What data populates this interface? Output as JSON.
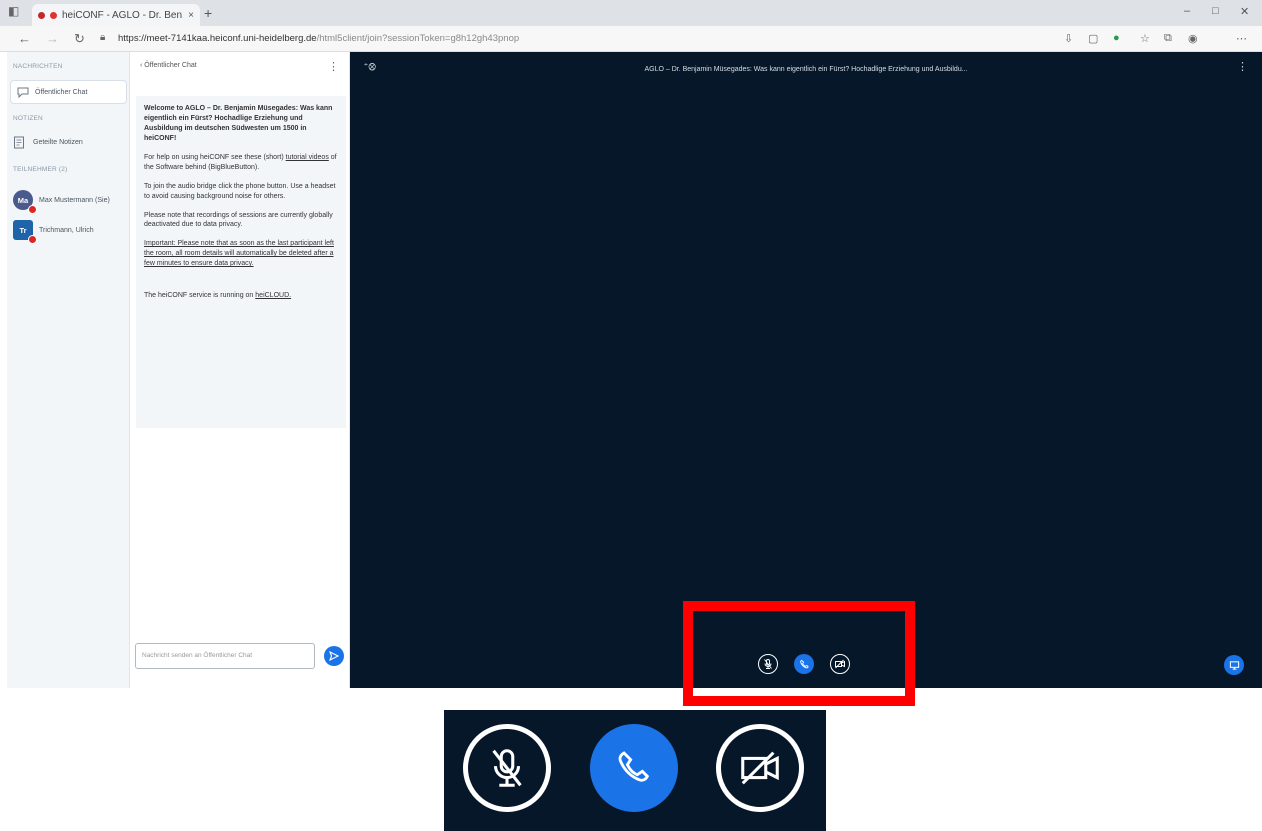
{
  "browser": {
    "tab_title": "hei­CONF - AGLO - Dr. Ben...",
    "tab_close": "×",
    "new_tab": "+",
    "url_host": "https://meet-7141kaa.heiconf.uni-heidelberg.de",
    "url_path": "/html5client/join?sessionToken=g8h12gh43pnop",
    "icons": [
      "back-icon",
      "forward-icon",
      "refresh-icon",
      "lock-icon"
    ]
  },
  "userlist": {
    "messages_title": "NACHRICHTEN",
    "public_chat": "Öffentlicher Chat",
    "notes_title": "NOTIZEN",
    "shared_notes": "Geteilte Notizen",
    "participants_title": "TEILNEHMER (2)",
    "users": [
      {
        "initials": "Ma",
        "name": "Max Mustermann (Sie)",
        "color": "#4a5a8c"
      },
      {
        "initials": "Tr",
        "name": "Trichmann, Ulrich",
        "color": "#1f64a8"
      }
    ]
  },
  "chat": {
    "header": "‹ Öffentlicher Chat",
    "welcome": {
      "heading": "Welcome to AGLO – Dr. Benjamin Müsegades: Was kann eigentlich ein Fürst? Hochadlige Erziehung und Ausbildung im deutschen Südwesten um 1500 in heiCONF!",
      "help_prefix": "For help on using heiCONF see these (short) ",
      "help_link": "tutorial videos",
      "help_suffix": " of the Software behind (BigBlueButton).",
      "audio": "To join the audio bridge click the phone button. Use a headset to avoid causing background noise for others.",
      "recordings": "Please note that recordings of sessions are currently globally deactivated due to data privacy.",
      "important": "Important: Please note that as soon as the last participant left the room, all room details will automatically be deleted after a few minutes to ensure data privacy.",
      "service_prefix": "The heiCONF service is running on ",
      "service_link": "heiCLOUD."
    },
    "input_placeholder": "Nachricht senden an Öffentlicher Chat"
  },
  "main": {
    "title": "AGLO – Dr. Benjamin Müsegades: Was kann eigentlich ein Fürst? Hochadlige Erziehung und Ausbildu..."
  },
  "colors": {
    "main_bg": "#06172a",
    "accent": "#1b73e8",
    "highlight": "#ff0000",
    "sidebar_bg": "#f3f6f9"
  }
}
